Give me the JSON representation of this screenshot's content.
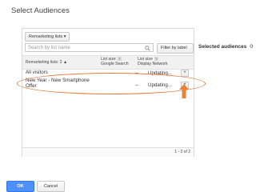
{
  "dialog": {
    "title": "Select Audiences"
  },
  "toolbar": {
    "remarketing_lists_label": "Remarketing lists",
    "search_placeholder": "Search by list name",
    "filter_label": "Filter by label"
  },
  "table": {
    "col_name": "Remarketing lists: 2",
    "col_size_search_line1": "List size",
    "col_size_search_line2": "Google Search",
    "col_size_display_line1": "List size",
    "col_size_display_line2": "Display Network",
    "help_glyph": "?",
    "rows": [
      {
        "name": "All visitors",
        "search_size": "--",
        "display_size": "Updating...",
        "add": "+"
      },
      {
        "name_line1": "New Year - New Smartphone",
        "name_line2": "Offer",
        "search_size": "--",
        "display_size": "Updating...",
        "add": "+"
      }
    ],
    "pagination": "1 - 2 of 2"
  },
  "selected": {
    "label": "Selected audiences",
    "count": "0"
  },
  "buttons": {
    "ok": "OK",
    "cancel": "Cancel"
  },
  "colors": {
    "accent": "#4d90fe",
    "highlight": "#e07a3a"
  },
  "icons": {
    "search": "search-icon",
    "dropdown": "chevron-down-icon",
    "sort": "sort-arrow-icon",
    "arrow": "up-arrow-icon"
  }
}
